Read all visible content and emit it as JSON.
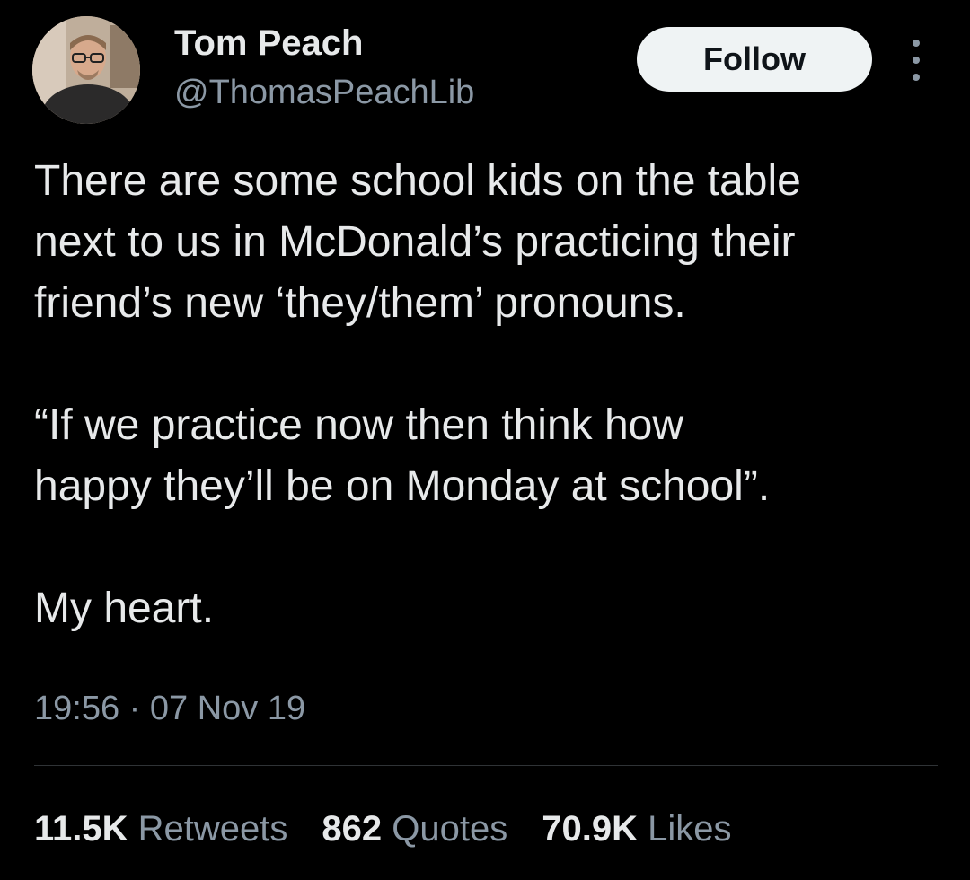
{
  "author": {
    "name": "Tom Peach",
    "handle": "@ThomasPeachLib"
  },
  "follow_label": "Follow",
  "tweet": {
    "paragraphs": [
      "There are some school kids on the table\nnext to us in McDonald’s practicing their\nfriend’s new ‘they/them’ pronouns.",
      "“If we practice now then think how\nhappy they’ll be on Monday at school”.",
      "My heart."
    ],
    "time": "19:56",
    "separator": "·",
    "date": "07 Nov 19"
  },
  "stats": {
    "retweets": {
      "value": "11.5K",
      "label": "Retweets"
    },
    "quotes": {
      "value": "862",
      "label": "Quotes"
    },
    "likes": {
      "value": "70.9K",
      "label": "Likes"
    }
  },
  "icons": {
    "more": "more-vertical-icon",
    "avatar": "user-avatar"
  },
  "colors": {
    "background": "#000000",
    "text_primary": "#e7e9ea",
    "text_secondary": "#8b98a5",
    "button_bg": "#eff3f4",
    "button_text": "#0f1419",
    "divider": "#2f3336"
  }
}
